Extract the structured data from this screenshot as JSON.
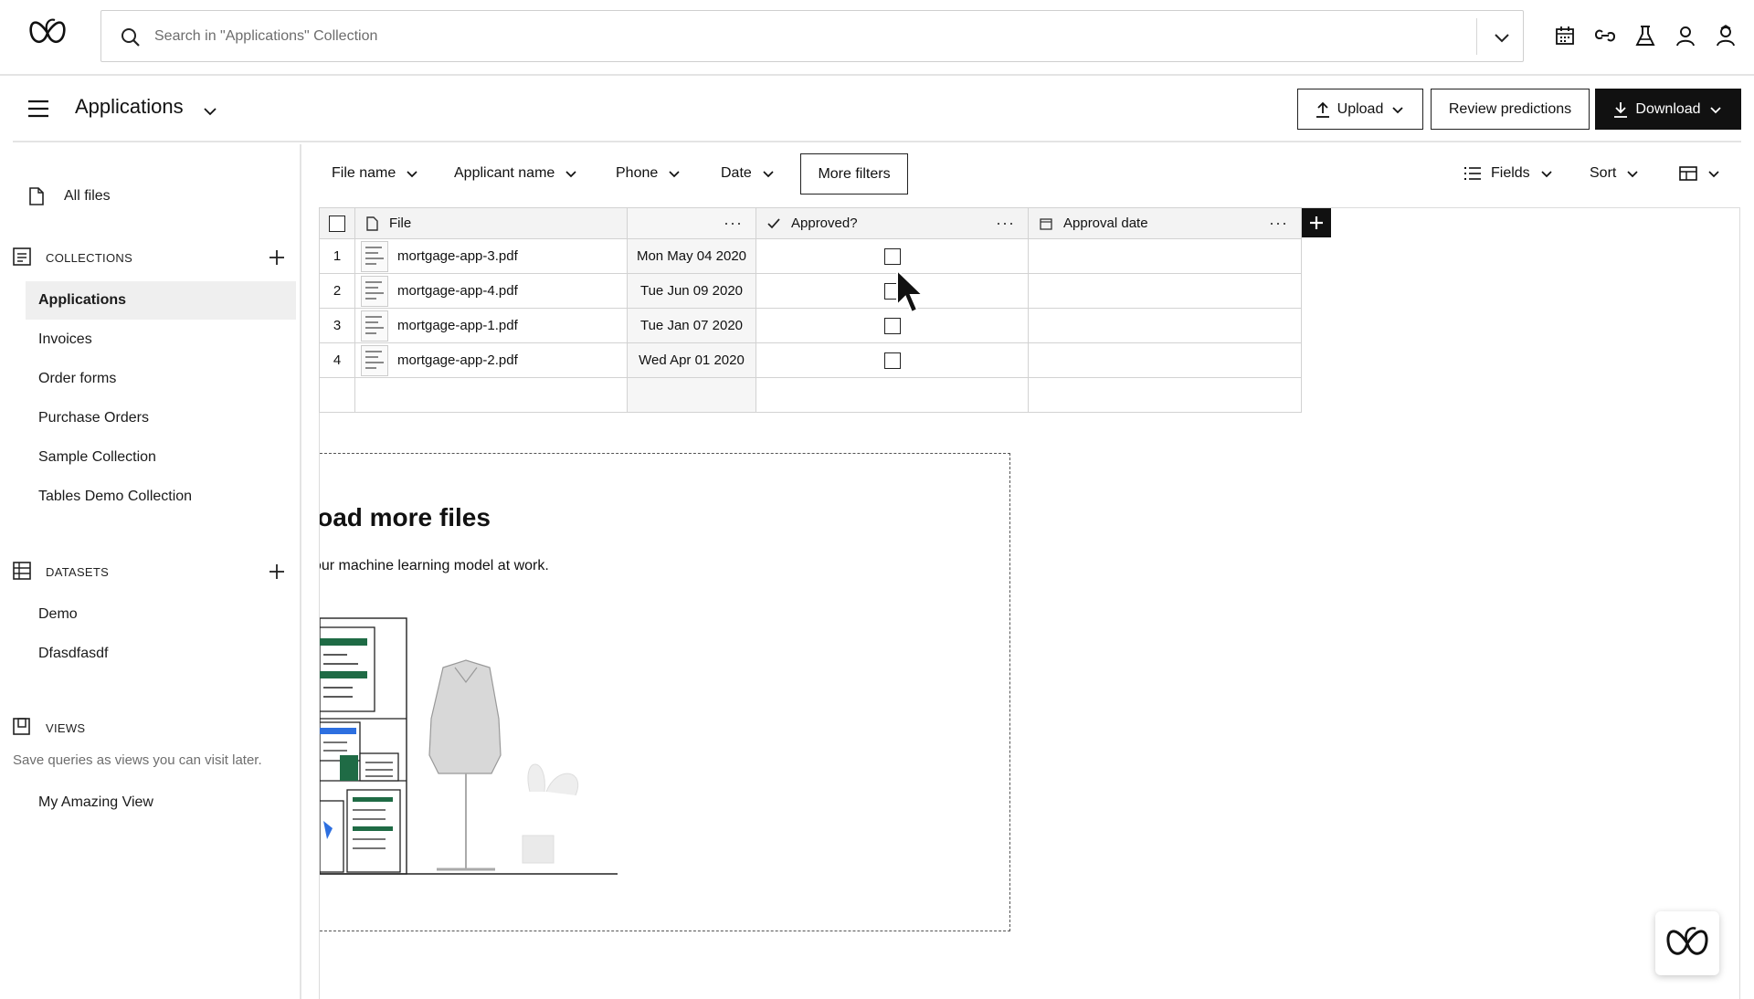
{
  "search": {
    "placeholder": "Search in \"Applications\" Collection"
  },
  "top_icons": [
    "calendar-icon",
    "link-icon",
    "flask-icon",
    "user-icon",
    "user-badge-icon"
  ],
  "header": {
    "title": "Applications",
    "upload_label": "Upload",
    "review_label": "Review predictions",
    "download_label": "Download"
  },
  "sidebar": {
    "all_files": "All files",
    "collections_label": "COLLECTIONS",
    "collections": [
      "Applications",
      "Invoices",
      "Order forms",
      "Purchase Orders",
      "Sample Collection",
      "Tables Demo Collection"
    ],
    "active_collection": "Applications",
    "datasets_label": "DATASETS",
    "datasets": [
      "Demo",
      "Dfasdfasdf"
    ],
    "views_label": "VIEWS",
    "views_hint": "Save queries as views you can visit later.",
    "views": [
      "My Amazing View"
    ]
  },
  "filters": {
    "items": [
      "File name",
      "Applicant name",
      "Phone",
      "Date"
    ],
    "more": "More filters",
    "fields": "Fields",
    "sort": "Sort"
  },
  "table": {
    "columns": {
      "file": "File",
      "date": "",
      "approved": "Approved?",
      "approval_date": "Approval date"
    },
    "rows": [
      {
        "index": "1",
        "file": "mortgage-app-3.pdf",
        "date": "Mon May 04 2020",
        "approved": false,
        "approval_date": ""
      },
      {
        "index": "2",
        "file": "mortgage-app-4.pdf",
        "date": "Tue Jun 09 2020",
        "approved": false,
        "approval_date": ""
      },
      {
        "index": "3",
        "file": "mortgage-app-1.pdf",
        "date": "Tue Jan 07 2020",
        "approved": false,
        "approval_date": ""
      },
      {
        "index": "4",
        "file": "mortgage-app-2.pdf",
        "date": "Wed Apr 01 2020",
        "approved": false,
        "approval_date": ""
      }
    ]
  },
  "upload_panel": {
    "title": "Upload more files",
    "subtitle": "See your machine learning model at work."
  },
  "colors": {
    "accent_dark": "#111111",
    "brand_green": "#1f6b45",
    "accent_blue": "#2d6fe0",
    "border": "#d2d2d2"
  }
}
